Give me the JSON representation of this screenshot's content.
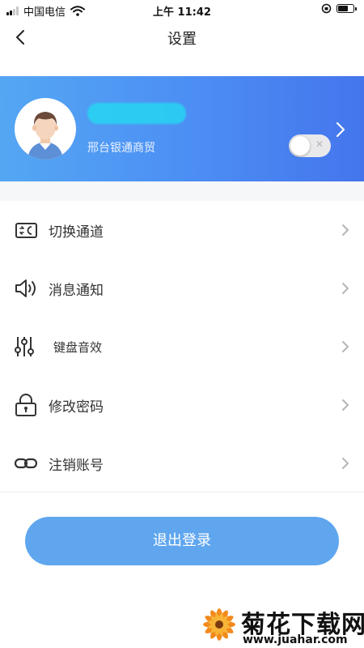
{
  "status_bar": {
    "carrier": "中国电信",
    "time": "上午 11:42",
    "battery_level": 0.7
  },
  "nav": {
    "title": "设置"
  },
  "profile": {
    "company": "邢台银通商贸"
  },
  "menu": [
    {
      "label": "切换通道",
      "icon": "channel-switch-icon"
    },
    {
      "label": "消息通知",
      "icon": "speaker-icon"
    },
    {
      "label": "键盘音效",
      "icon": "sliders-icon",
      "toggle_on": false
    },
    {
      "label": "修改密码",
      "icon": "lock-icon"
    },
    {
      "label": "注销账号",
      "icon": "link-icon"
    }
  ],
  "logout_label": "退出登录",
  "watermark": {
    "text": "菊花下载网",
    "url": "www.juahar.com"
  },
  "colors": {
    "profile_gradient_start": "#54a7f3",
    "profile_gradient_end": "#4475ec",
    "logout_button": "#5fa6ef",
    "redaction": "#27d5f2"
  }
}
